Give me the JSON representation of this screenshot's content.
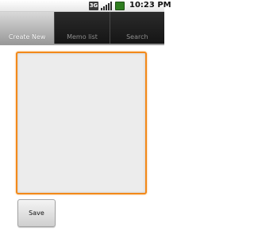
{
  "status_bar": {
    "data_label": "3G",
    "time": "10:23 PM",
    "icons": [
      "data-activity-icon",
      "signal-strength-icon",
      "battery-icon"
    ]
  },
  "tabs": [
    {
      "label": "Create New",
      "selected": true
    },
    {
      "label": "Memo list",
      "selected": false
    },
    {
      "label": "Search",
      "selected": false
    }
  ],
  "memo": {
    "value": "",
    "placeholder": ""
  },
  "actions": {
    "save_label": "Save"
  },
  "colors": {
    "focus_accent": "#f2891a",
    "tab_active": "#bdbdbd",
    "tab_inactive": "#1f1f1f"
  }
}
